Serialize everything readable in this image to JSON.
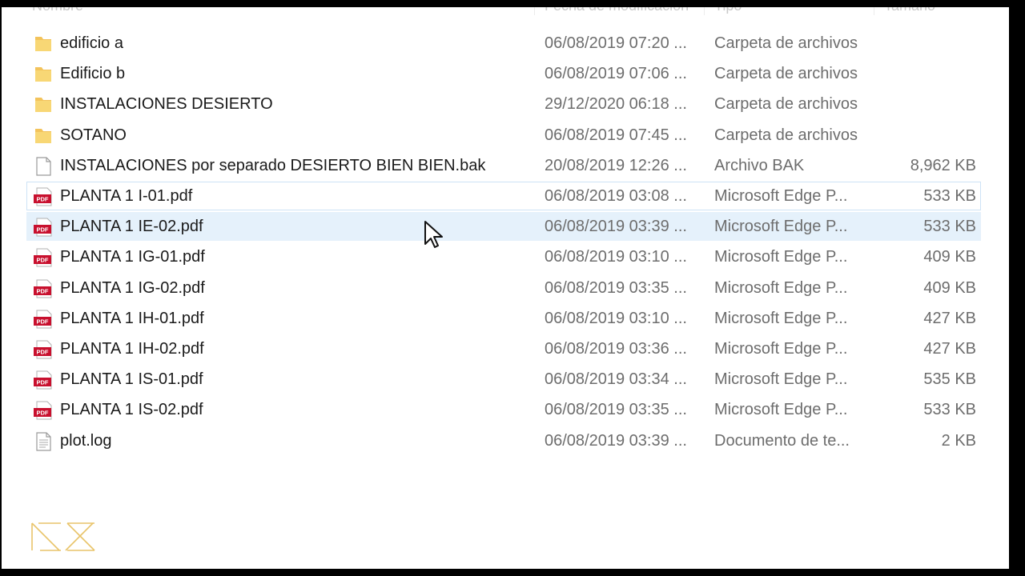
{
  "header": {
    "name_label": "Nombre",
    "date_label": "Fecha de modificación",
    "type_label": "Tipo",
    "size_label": "Tamaño"
  },
  "files": [
    {
      "name": "edificio a",
      "date": "06/08/2019 07:20 ...",
      "type": "Carpeta de archivos",
      "size": "",
      "icon": "folder-icon"
    },
    {
      "name": "Edificio b",
      "date": "06/08/2019 07:06 ...",
      "type": "Carpeta de archivos",
      "size": "",
      "icon": "folder-icon"
    },
    {
      "name": "INSTALACIONES DESIERTO",
      "date": "29/12/2020 06:18 ...",
      "type": "Carpeta de archivos",
      "size": "",
      "icon": "folder-icon"
    },
    {
      "name": "SOTANO",
      "date": "06/08/2019 07:45 ...",
      "type": "Carpeta de archivos",
      "size": "",
      "icon": "folder-icon"
    },
    {
      "name": "INSTALACIONES por separado DESIERTO BIEN BIEN.bak",
      "date": "20/08/2019 12:26 ...",
      "type": "Archivo BAK",
      "size": "8,962 KB",
      "icon": "blank-file-icon"
    },
    {
      "name": "PLANTA 1 I-01.pdf",
      "date": "06/08/2019 03:08 ...",
      "type": "Microsoft Edge P...",
      "size": "533 KB",
      "icon": "pdf-file-icon"
    },
    {
      "name": "PLANTA 1 IE-02.pdf",
      "date": "06/08/2019 03:39 ...",
      "type": "Microsoft Edge P...",
      "size": "533 KB",
      "icon": "pdf-file-icon"
    },
    {
      "name": "PLANTA 1 IG-01.pdf",
      "date": "06/08/2019 03:10 ...",
      "type": "Microsoft Edge P...",
      "size": "409 KB",
      "icon": "pdf-file-icon"
    },
    {
      "name": "PLANTA 1 IG-02.pdf",
      "date": "06/08/2019 03:35 ...",
      "type": "Microsoft Edge P...",
      "size": "409 KB",
      "icon": "pdf-file-icon"
    },
    {
      "name": "PLANTA 1 IH-01.pdf",
      "date": "06/08/2019 03:10 ...",
      "type": "Microsoft Edge P...",
      "size": "427 KB",
      "icon": "pdf-file-icon"
    },
    {
      "name": "PLANTA 1 IH-02.pdf",
      "date": "06/08/2019 03:36 ...",
      "type": "Microsoft Edge P...",
      "size": "427 KB",
      "icon": "pdf-file-icon"
    },
    {
      "name": "PLANTA 1 IS-01.pdf",
      "date": "06/08/2019 03:34 ...",
      "type": "Microsoft Edge P...",
      "size": "535 KB",
      "icon": "pdf-file-icon"
    },
    {
      "name": "PLANTA 1 IS-02.pdf",
      "date": "06/08/2019 03:35 ...",
      "type": "Microsoft Edge P...",
      "size": "533 KB",
      "icon": "pdf-file-icon"
    },
    {
      "name": "plot.log",
      "date": "06/08/2019 03:39 ...",
      "type": "Documento de te...",
      "size": "2 KB",
      "icon": "text-file-icon"
    }
  ],
  "selection": {
    "selected_row": 5,
    "hover_row": 6
  },
  "colors": {
    "folder": "#f8d775",
    "pdf_red": "#c8102e",
    "selection_border": "#cde3f6",
    "hover_bg": "#e5f1fb",
    "logo_gold": "#e9c46a"
  },
  "pdf_badge_text": "PDF"
}
